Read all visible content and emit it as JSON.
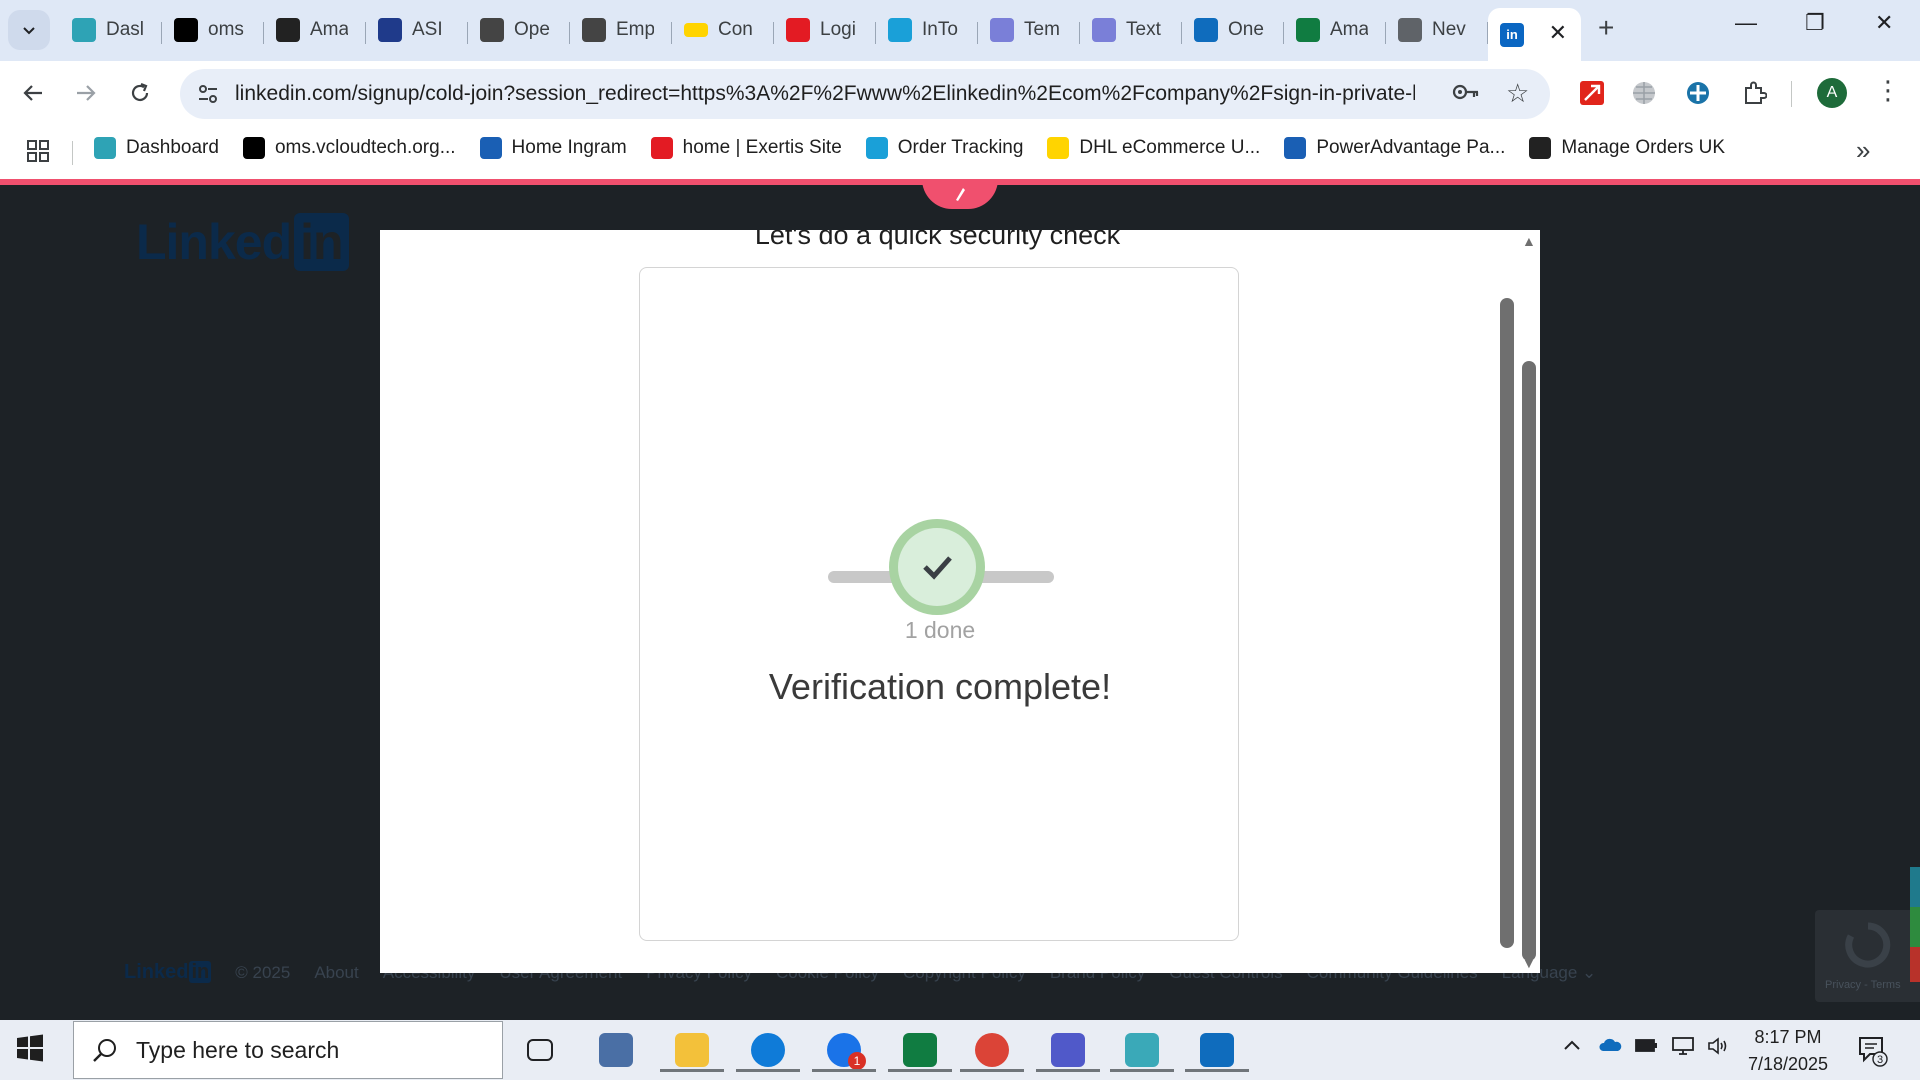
{
  "browser": {
    "tabs": [
      {
        "label": "Dasl",
        "favicon": "hexagon-teal",
        "color": "#2ea3b5"
      },
      {
        "label": "oms",
        "favicon": "black-triangle",
        "color": "#000000"
      },
      {
        "label": "Ama",
        "favicon": "amazon-a",
        "color": "#222222"
      },
      {
        "label": "ASI",
        "favicon": "chevron-blue",
        "color": "#1f3a8a"
      },
      {
        "label": "Ope",
        "favicon": "openai-knot",
        "color": "#444444"
      },
      {
        "label": "Emp",
        "favicon": "openai-knot",
        "color": "#444444"
      },
      {
        "label": "Con",
        "favicon": "dhl-yellow",
        "color": "#ffd400"
      },
      {
        "label": "Logi",
        "favicon": "exertis-ex",
        "color": "#e31b23"
      },
      {
        "label": "InTo",
        "favicon": "c-circle",
        "color": "#1aa0d8"
      },
      {
        "label": "Tem",
        "favicon": "doc-icon",
        "color": "#7a7fd8"
      },
      {
        "label": "Text",
        "favicon": "doc-icon",
        "color": "#7a7fd8"
      },
      {
        "label": "One",
        "favicon": "onedrive-cloud",
        "color": "#0f6cbd"
      },
      {
        "label": "Ama",
        "favicon": "excel-x",
        "color": "#107c41"
      },
      {
        "label": "Nev",
        "favicon": "chrome-gray",
        "color": "#5f6368"
      }
    ],
    "active_tab": {
      "favicon": "linkedin-in",
      "color": "#0a66c2",
      "close": "✕"
    },
    "new_tab": "+",
    "url": "linkedin.com/signup/cold-join?session_redirect=https%3A%2F%2Fwww%2Elinkedin%2Ecom%2Fcompany%2Fsign-in-private-li...",
    "avatar_letter": "A",
    "bookmarks": [
      {
        "label": "Dashboard",
        "icon": "hexagon-teal",
        "color": "#2ea3b5"
      },
      {
        "label": "oms.vcloudtech.org...",
        "icon": "black-triangle",
        "color": "#000000"
      },
      {
        "label": "Home Ingram",
        "icon": "ingram-flag",
        "color": "#1a5fb4"
      },
      {
        "label": "home | Exertis Site",
        "icon": "exertis-ex",
        "color": "#e31b23"
      },
      {
        "label": "Order Tracking",
        "icon": "c-circle",
        "color": "#1aa0d8"
      },
      {
        "label": "DHL eCommerce U...",
        "icon": "dhl-yellow",
        "color": "#ffd400"
      },
      {
        "label": "PowerAdvantage Pa...",
        "icon": "pa-flag",
        "color": "#1a5fb4"
      },
      {
        "label": "Manage Orders UK",
        "icon": "amazon-a",
        "color": "#222222"
      }
    ],
    "bookmarks_more": "»"
  },
  "page": {
    "logo_text": "Linked",
    "logo_in": "in",
    "footer": {
      "logo": "Linked",
      "logo_in": "in",
      "copyright": "© 2025",
      "links": [
        "About",
        "Accessibility",
        "User Agreement",
        "Privacy Policy",
        "Cookie Policy",
        "Copyright Policy",
        "Brand Policy",
        "Guest Controls",
        "Community Guidelines",
        "Language"
      ]
    },
    "recaptcha_label": "Privacy - Terms",
    "modal": {
      "title": "Let's do a quick security check",
      "progress_done": "1 done",
      "message": "Verification complete!"
    }
  },
  "taskbar": {
    "search_placeholder": "Type here to search",
    "apps": [
      {
        "name": "task-view",
        "color": "#202124"
      },
      {
        "name": "calculator",
        "color": "#4a6fa5"
      },
      {
        "name": "file-explorer",
        "color": "#f3c13a"
      },
      {
        "name": "edge",
        "color": "#0f7bd8"
      },
      {
        "name": "zoho",
        "color": "#1a73e8",
        "badge": "1"
      },
      {
        "name": "excel",
        "color": "#107c41"
      },
      {
        "name": "chrome",
        "color": "#db4437"
      },
      {
        "name": "teams",
        "color": "#5059c9"
      },
      {
        "name": "app-hexagon",
        "color": "#3aa9b8"
      },
      {
        "name": "outlook",
        "color": "#0f6cbd"
      }
    ],
    "time": "8:17 PM",
    "date": "7/18/2025",
    "notification_count": "3"
  }
}
